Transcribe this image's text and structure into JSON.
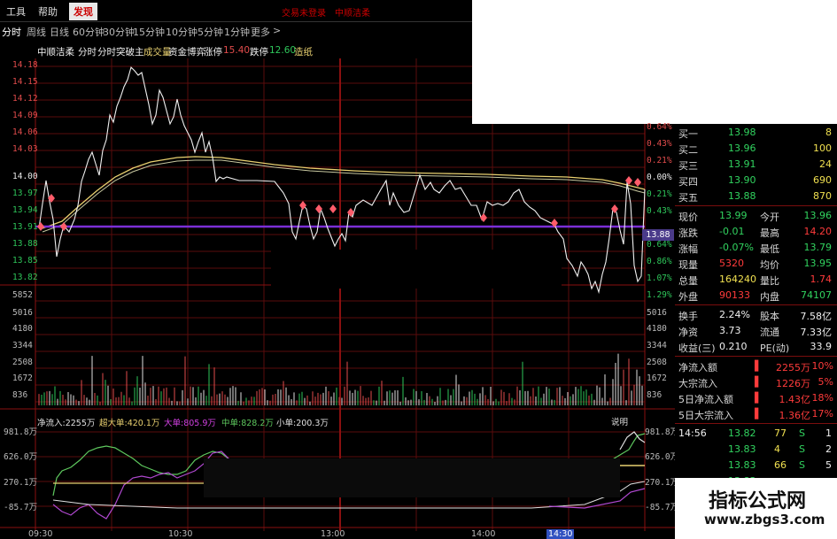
{
  "menubar": {
    "items": [
      "工具",
      "帮助",
      "发现"
    ],
    "red_items": [
      "交易未登录",
      "中顺洁柔"
    ]
  },
  "periods": [
    "分时",
    "周线",
    "日线",
    "60分钟",
    "30分钟",
    "15分钟",
    "10分钟",
    "5分钟",
    "1分钟",
    "更多",
    ">"
  ],
  "titlebar": {
    "stock": "中顺洁柔",
    "t1": "分时",
    "t2": "分时突破主",
    "t3": "成交量",
    "t4": "资金博弈",
    "t5": "涨停",
    "t5v": "15.40",
    "t6": "跌停",
    "t6v": "12.60",
    "t7": "造纸"
  },
  "price_axis_left": [
    "14.18",
    "14.15",
    "14.12",
    "14.09",
    "14.06",
    "14.03",
    "14.00",
    "13.97",
    "13.94",
    "13.91",
    "13.88",
    "13.85",
    "13.82"
  ],
  "pct_axis_right": [
    "0.64%",
    "0.43%",
    "0.21%",
    "0.00%",
    "0.21%",
    "0.43%",
    "0.64%",
    "0.86%",
    "1.07%",
    "1.29%"
  ],
  "current_price_tag": "13.88",
  "volume_axis": [
    "5852",
    "5016",
    "4180",
    "3344",
    "2508",
    "1672",
    "836"
  ],
  "flow_axis": [
    "981.8万",
    "626.0万",
    "270.1万",
    "-85.7万"
  ],
  "indicator": {
    "net": "净流入:2255万",
    "super": "超大单:420.1万",
    "big": "大单:805.9万",
    "mid": "中单:828.2万",
    "small": "小单:200.3万",
    "help": "说明"
  },
  "times": [
    "09:30",
    "10:30",
    "13:00",
    "14:00",
    "14:30"
  ],
  "order_book": [
    {
      "label": "买一",
      "price": "13.98",
      "vol": "8"
    },
    {
      "label": "买二",
      "price": "13.96",
      "vol": "100"
    },
    {
      "label": "买三",
      "price": "13.91",
      "vol": "24"
    },
    {
      "label": "买四",
      "price": "13.90",
      "vol": "690"
    },
    {
      "label": "买五",
      "price": "13.88",
      "vol": "870"
    }
  ],
  "quote": [
    {
      "l1": "现价",
      "v1": "13.99",
      "l2": "今开",
      "v2": "13.96"
    },
    {
      "l1": "涨跌",
      "v1": "-0.01",
      "l2": "最高",
      "v2": "14.20"
    },
    {
      "l1": "涨幅",
      "v1": "-0.07%",
      "l2": "最低",
      "v2": "13.79"
    },
    {
      "l1": "现量",
      "v1": "5320",
      "l2": "均价",
      "v2": "13.95"
    },
    {
      "l1": "总量",
      "v1": "164240",
      "l2": "量比",
      "v2": "1.74"
    },
    {
      "l1": "外盘",
      "v1": "90133",
      "l2": "内盘",
      "v2": "74107"
    }
  ],
  "stats": [
    {
      "l1": "换手",
      "v1": "2.24%",
      "l2": "股本",
      "v2": "7.58亿"
    },
    {
      "l1": "净资",
      "v1": "3.73",
      "l2": "流通",
      "v2": "7.33亿"
    },
    {
      "l1": "收益(三)",
      "v1": "0.210",
      "l2": "PE(动)",
      "v2": "33.9"
    }
  ],
  "flows": [
    {
      "label": "净流入额",
      "value": "2255万",
      "pct": "10%"
    },
    {
      "label": "大宗流入",
      "value": "1226万",
      "pct": "5%"
    },
    {
      "label": "5日净流入额",
      "value": "1.43亿",
      "pct": "18%"
    },
    {
      "label": "5日大宗流入",
      "value": "1.36亿",
      "pct": "17%"
    }
  ],
  "ticks": [
    {
      "time": "14:56",
      "price": "13.82",
      "vol": "77",
      "side": "S",
      "n": "1"
    },
    {
      "time": "",
      "price": "13.83",
      "vol": "4",
      "side": "S",
      "n": "2"
    },
    {
      "time": "",
      "price": "13.83",
      "vol": "66",
      "side": "S",
      "n": "5"
    },
    {
      "time": "",
      "price": "13.83",
      "vol": "",
      "side": "",
      "n": ""
    }
  ],
  "watermark": {
    "title": "指标公式网",
    "url": "www.zbgs3.com"
  },
  "colors": {
    "red": "#e24c4c",
    "green": "#2ec65a",
    "purple": "#8a2be2",
    "yellow": "#e8d070",
    "white": "#f0f0f0",
    "grid": "#7a0d0d"
  }
}
